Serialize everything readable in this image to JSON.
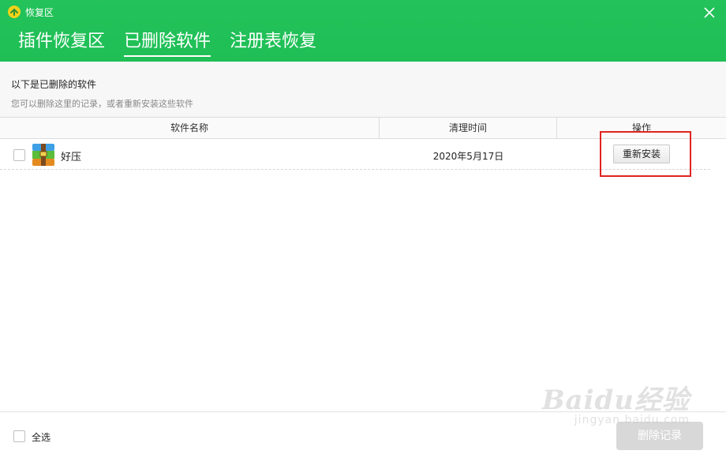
{
  "window": {
    "title": "恢复区",
    "close_icon": "close-icon"
  },
  "tabs": [
    {
      "label": "插件恢复区",
      "active": false
    },
    {
      "label": "已删除软件",
      "active": true
    },
    {
      "label": "注册表恢复",
      "active": false
    }
  ],
  "info": {
    "title": "以下是已删除的软件",
    "subtitle": "您可以删除这里的记录，或者重新安装这些软件"
  },
  "table": {
    "columns": [
      "软件名称",
      "清理时间",
      "操作"
    ],
    "rows": [
      {
        "name": "好压",
        "time": "2020年5月17日",
        "action": "重新安装",
        "icon": "haozip-package-icon",
        "checked": false
      }
    ]
  },
  "footer": {
    "select_all_label": "全选",
    "action_button": "删除记录"
  },
  "watermark": {
    "logo": "Baidu经验",
    "url": "jingyan.baidu.com"
  },
  "colors": {
    "header_green": "#1fbf56",
    "highlight_red": "#e0231f"
  }
}
